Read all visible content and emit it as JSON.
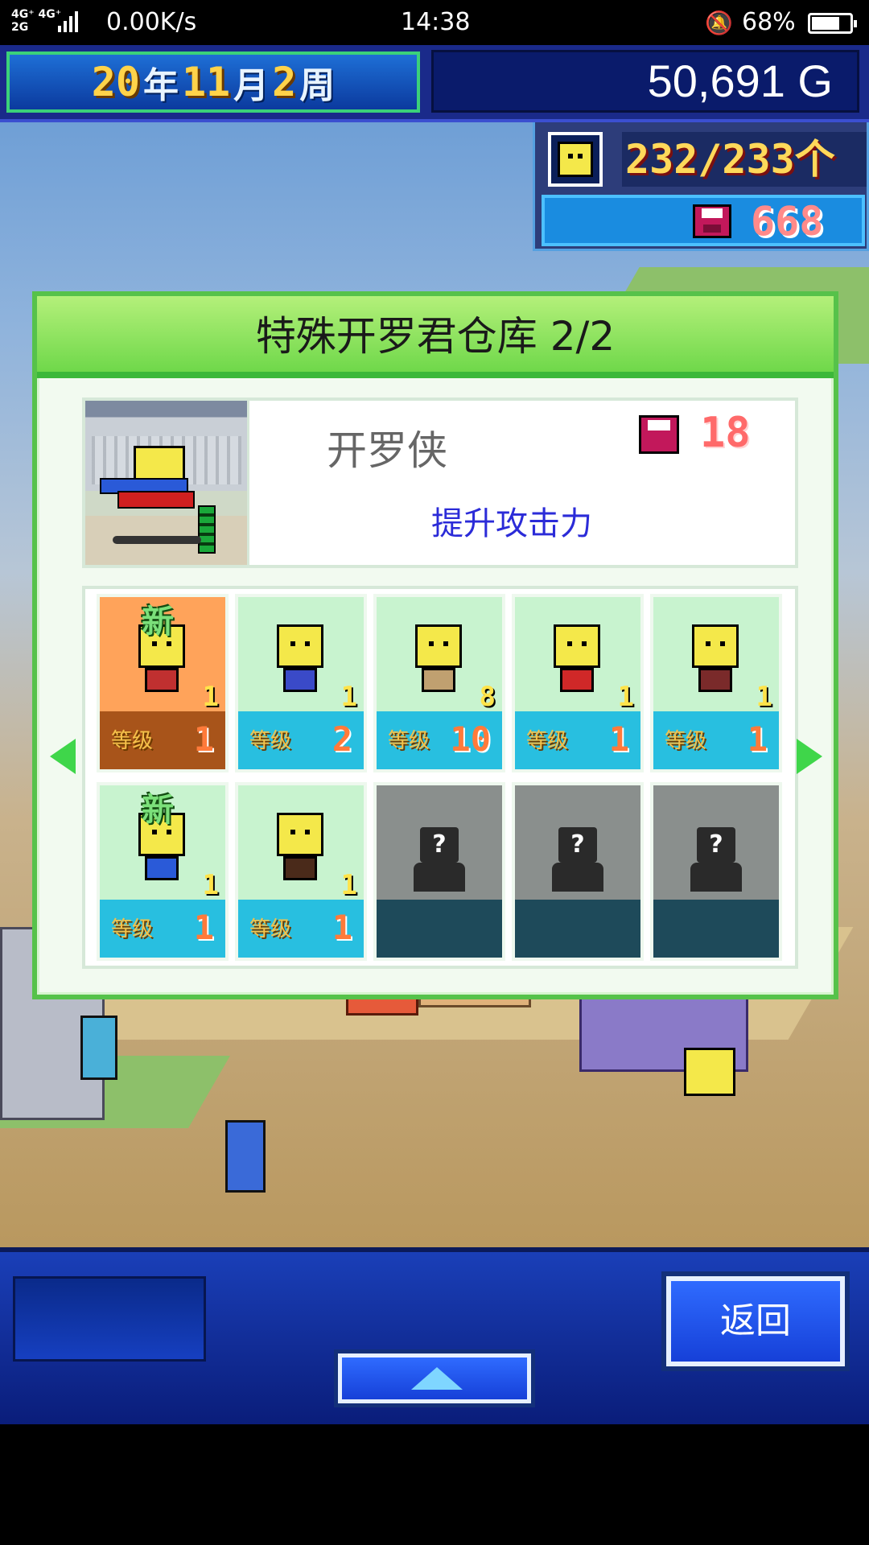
{
  "status_bar": {
    "network": "4G⁺ 4G⁺\n2G",
    "speed": "0.00K/s",
    "time": "14:38",
    "battery": "68%",
    "battery_level": 0.68,
    "bell_icon": "bell-muted-icon"
  },
  "top_bar": {
    "date": [
      {
        "n": "20",
        "u": "年"
      },
      {
        "n": "11",
        "u": "月"
      },
      {
        "n": "2",
        "u": "周"
      }
    ],
    "money": "50,691 G"
  },
  "resources": {
    "population": "232/233",
    "population_arrow": "个",
    "research_points": "668"
  },
  "dialog": {
    "title": "特殊开罗君仓库 2/2",
    "selected": {
      "name": "开罗侠",
      "cost": "18",
      "description": "提升攻击力"
    },
    "slots": [
      {
        "new": "新",
        "count": "1",
        "level_label": "等级",
        "level": "1",
        "selected": true,
        "locked": false
      },
      {
        "new": "",
        "count": "1",
        "level_label": "等级",
        "level": "2",
        "selected": false,
        "locked": false
      },
      {
        "new": "",
        "count": "8",
        "level_label": "等级",
        "level": "10",
        "selected": false,
        "locked": false
      },
      {
        "new": "",
        "count": "1",
        "level_label": "等级",
        "level": "1",
        "selected": false,
        "locked": false
      },
      {
        "new": "",
        "count": "1",
        "level_label": "等级",
        "level": "1",
        "selected": false,
        "locked": false
      },
      {
        "new": "新",
        "count": "1",
        "level_label": "等级",
        "level": "1",
        "selected": false,
        "locked": false
      },
      {
        "new": "",
        "count": "1",
        "level_label": "等级",
        "level": "1",
        "selected": false,
        "locked": false
      },
      {
        "new": "",
        "count": "",
        "level_label": "",
        "level": "",
        "selected": false,
        "locked": true,
        "lock_mark": "?"
      },
      {
        "new": "",
        "count": "",
        "level_label": "",
        "level": "",
        "selected": false,
        "locked": true,
        "lock_mark": "?"
      },
      {
        "new": "",
        "count": "",
        "level_label": "",
        "level": "",
        "selected": false,
        "locked": true,
        "lock_mark": "?"
      }
    ]
  },
  "bottom_bar": {
    "back_label": "返回"
  },
  "colors": {
    "dialog_header": "#6fd84a",
    "slot_bg": "#c8f3cf",
    "selected_slot": "#ffa35a",
    "level_bar": "#28bfe0",
    "description_text": "#2b2bd8"
  }
}
